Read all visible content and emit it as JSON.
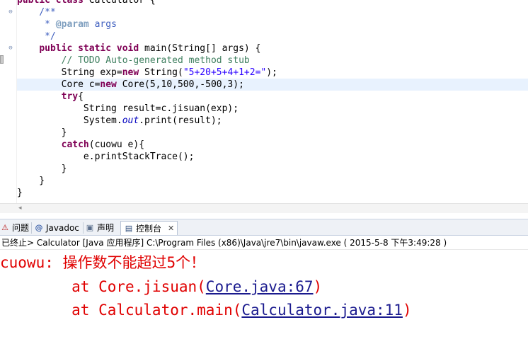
{
  "editor": {
    "lines": [
      [
        {
          "t": "public class ",
          "c": "kw"
        },
        {
          "t": "Calculator {",
          "c": ""
        }
      ],
      [
        {
          "t": "    /**",
          "c": "jd"
        }
      ],
      [
        {
          "t": "     * ",
          "c": "jd"
        },
        {
          "t": "@param",
          "c": "jdt"
        },
        {
          "t": " args",
          "c": "jd"
        }
      ],
      [
        {
          "t": "     */",
          "c": "jd"
        }
      ],
      [
        {
          "t": "    ",
          "c": ""
        },
        {
          "t": "public static void",
          "c": "kw"
        },
        {
          "t": " main(String[] args) {",
          "c": ""
        }
      ],
      [
        {
          "t": "        ",
          "c": ""
        },
        {
          "t": "// ",
          "c": "cm"
        },
        {
          "t": "TODO",
          "c": "cm"
        },
        {
          "t": " Auto-generated method stub",
          "c": "cm"
        }
      ],
      [
        {
          "t": "        String exp=",
          "c": ""
        },
        {
          "t": "new",
          "c": "kw"
        },
        {
          "t": " String(",
          "c": ""
        },
        {
          "t": "\"5+20+5+4+1+2=\"",
          "c": "str"
        },
        {
          "t": ");",
          "c": ""
        }
      ],
      [
        {
          "t": "        Core c=",
          "c": ""
        },
        {
          "t": "new",
          "c": "kw"
        },
        {
          "t": " Core(5,10,500,-500,3);",
          "c": ""
        }
      ],
      [
        {
          "t": "        ",
          "c": ""
        },
        {
          "t": "try",
          "c": "kw"
        },
        {
          "t": "{",
          "c": ""
        }
      ],
      [
        {
          "t": "            String result=c.jisuan(exp);",
          "c": ""
        }
      ],
      [
        {
          "t": "            System.",
          "c": ""
        },
        {
          "t": "out",
          "c": "fld"
        },
        {
          "t": ".print(result);",
          "c": ""
        }
      ],
      [
        {
          "t": "        }",
          "c": ""
        }
      ],
      [
        {
          "t": "        ",
          "c": ""
        },
        {
          "t": "catch",
          "c": "kw"
        },
        {
          "t": "(cuowu e){",
          "c": ""
        }
      ],
      [
        {
          "t": "            e.printStackTrace();",
          "c": ""
        }
      ],
      [
        {
          "t": "        }",
          "c": ""
        }
      ],
      [
        {
          "t": "    }",
          "c": ""
        }
      ],
      [
        {
          "t": "}",
          "c": ""
        }
      ]
    ],
    "current_line_index": 7,
    "fold_markers": [
      "⊖",
      "⊖"
    ]
  },
  "tabs": {
    "problems": "问题",
    "javadoc": "Javadoc",
    "declaration": "声明",
    "console": "控制台",
    "close": "✕"
  },
  "console": {
    "header": "已终止> Calculator [Java 应用程序] C:\\Program Files (x86)\\Java\\jre7\\bin\\javaw.exe ( 2015-5-8 下午3:49:28 )",
    "error_line": "cuowu: 操作数不能超过5个！",
    "trace": [
      {
        "prefix": "        at Core.jisuan(",
        "link": "Core.java:67",
        "suffix": ")"
      },
      {
        "prefix": "        at Calculator.main(",
        "link": "Calculator.java:11",
        "suffix": ")"
      }
    ]
  },
  "colors": {
    "keyword": "#7f0055",
    "comment": "#3f7f5f",
    "javadoc": "#3f5fbf",
    "string": "#2a00ff",
    "console_error": "#e00000",
    "console_link": "#1a1a8e",
    "current_line": "#e8f2fe"
  }
}
